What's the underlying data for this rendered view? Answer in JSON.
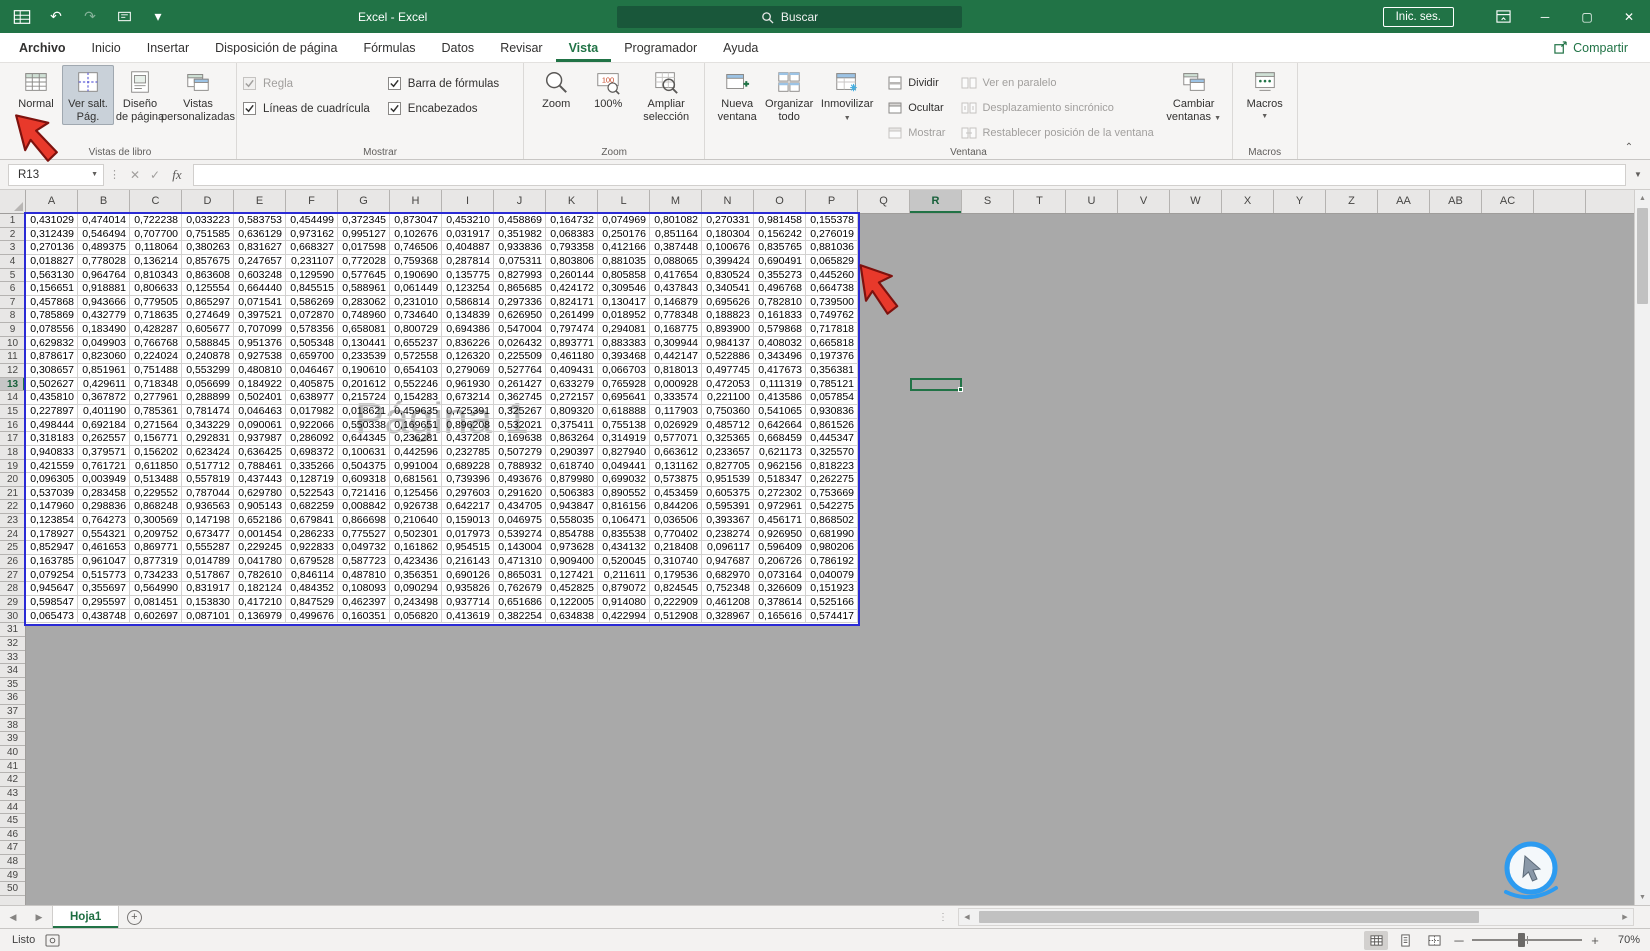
{
  "titlebar": {
    "title": "Excel  -  Excel",
    "search_label": "Buscar",
    "sign_in_label": "Inic. ses."
  },
  "menubar": {
    "tabs": [
      "Archivo",
      "Inicio",
      "Insertar",
      "Disposición de página",
      "Fórmulas",
      "Datos",
      "Revisar",
      "Vista",
      "Programador",
      "Ayuda"
    ],
    "active_tab": "Vista",
    "share_label": "Compartir"
  },
  "ribbon": {
    "book_views": {
      "group_label": "Vistas de libro",
      "normal": "Normal",
      "page_break_line1": "Ver salt.",
      "page_break_line2": "Pág.",
      "page_layout_line1": "Diseño",
      "page_layout_line2": "de página",
      "custom_line1": "Vistas",
      "custom_line2": "personalizadas"
    },
    "show": {
      "group_label": "Mostrar",
      "ruler": "Regla",
      "gridlines": "Líneas de cuadrícula",
      "formula_bar": "Barra de fórmulas",
      "headings": "Encabezados"
    },
    "zoom": {
      "group_label": "Zoom",
      "zoom": "Zoom",
      "hundred": "100%",
      "hundred_icon_text": "100",
      "selection_line1": "Ampliar",
      "selection_line2": "selección"
    },
    "window": {
      "group_label": "Ventana",
      "new_line1": "Nueva",
      "new_line2": "ventana",
      "arrange_line1": "Organizar",
      "arrange_line2": "todo",
      "freeze": "Inmovilizar",
      "split": "Dividir",
      "hide": "Ocultar",
      "unhide": "Mostrar",
      "parallel": "Ver en paralelo",
      "sync": "Desplazamiento sincrónico",
      "reset": "Restablecer posición de la ventana",
      "switch_line1": "Cambiar",
      "switch_line2": "ventanas"
    },
    "macros": {
      "group_label": "Macros",
      "macros": "Macros"
    }
  },
  "formula_bar": {
    "name_box": "R13",
    "fx_label": "fx"
  },
  "sheet": {
    "columns": [
      "A",
      "B",
      "C",
      "D",
      "E",
      "F",
      "G",
      "H",
      "I",
      "J",
      "K",
      "L",
      "M",
      "N",
      "O",
      "P",
      "Q",
      "R",
      "S",
      "T",
      "U",
      "V",
      "W",
      "X",
      "Y",
      "Z",
      "AA",
      "AB",
      "AC"
    ],
    "row_count": 50,
    "selected_column": "R",
    "selected_row": 13,
    "watermark": "Página 1",
    "rows": [
      [
        "0,431029",
        "0,474014",
        "0,722238",
        "0,033223",
        "0,583753",
        "0,454499",
        "0,372345",
        "0,873047",
        "0,453210",
        "0,458869",
        "0,164732",
        "0,074969",
        "0,801082",
        "0,270331",
        "0,981458",
        "0,155378"
      ],
      [
        "0,312439",
        "0,546494",
        "0,707700",
        "0,751585",
        "0,636129",
        "0,973162",
        "0,995127",
        "0,102676",
        "0,031917",
        "0,351982",
        "0,068383",
        "0,250176",
        "0,851164",
        "0,180304",
        "0,156242",
        "0,276019"
      ],
      [
        "0,270136",
        "0,489375",
        "0,118064",
        "0,380263",
        "0,831627",
        "0,668327",
        "0,017598",
        "0,746506",
        "0,404887",
        "0,933836",
        "0,793358",
        "0,412166",
        "0,387448",
        "0,100676",
        "0,835765",
        "0,881036"
      ],
      [
        "0,018827",
        "0,778028",
        "0,136214",
        "0,857675",
        "0,247657",
        "0,231107",
        "0,772028",
        "0,759368",
        "0,287814",
        "0,075311",
        "0,803806",
        "0,881035",
        "0,088065",
        "0,399424",
        "0,690491",
        "0,065829"
      ],
      [
        "0,563130",
        "0,964764",
        "0,810343",
        "0,863608",
        "0,603248",
        "0,129590",
        "0,577645",
        "0,190690",
        "0,135775",
        "0,827993",
        "0,260144",
        "0,805858",
        "0,417654",
        "0,830524",
        "0,355273",
        "0,445260"
      ],
      [
        "0,156651",
        "0,918881",
        "0,806633",
        "0,125554",
        "0,664440",
        "0,845515",
        "0,588961",
        "0,061449",
        "0,123254",
        "0,865685",
        "0,424172",
        "0,309546",
        "0,437843",
        "0,340541",
        "0,496768",
        "0,664738"
      ],
      [
        "0,457868",
        "0,943666",
        "0,779505",
        "0,865297",
        "0,071541",
        "0,586269",
        "0,283062",
        "0,231010",
        "0,586814",
        "0,297336",
        "0,824171",
        "0,130417",
        "0,146879",
        "0,695626",
        "0,782810",
        "0,739500"
      ],
      [
        "0,785869",
        "0,432779",
        "0,718635",
        "0,274649",
        "0,397521",
        "0,072870",
        "0,748960",
        "0,734640",
        "0,134839",
        "0,626950",
        "0,261499",
        "0,018952",
        "0,778348",
        "0,188823",
        "0,161833",
        "0,749762"
      ],
      [
        "0,078556",
        "0,183490",
        "0,428287",
        "0,605677",
        "0,707099",
        "0,578356",
        "0,658081",
        "0,800729",
        "0,694386",
        "0,547004",
        "0,797474",
        "0,294081",
        "0,168775",
        "0,893900",
        "0,579868",
        "0,717818"
      ],
      [
        "0,629832",
        "0,049903",
        "0,766768",
        "0,588845",
        "0,951376",
        "0,505348",
        "0,130441",
        "0,655237",
        "0,836226",
        "0,026432",
        "0,893771",
        "0,883383",
        "0,309944",
        "0,984137",
        "0,408032",
        "0,665818"
      ],
      [
        "0,878617",
        "0,823060",
        "0,224024",
        "0,240878",
        "0,927538",
        "0,659700",
        "0,233539",
        "0,572558",
        "0,126320",
        "0,225509",
        "0,461180",
        "0,393468",
        "0,442147",
        "0,522886",
        "0,343496",
        "0,197376"
      ],
      [
        "0,308657",
        "0,851961",
        "0,751488",
        "0,553299",
        "0,480810",
        "0,046467",
        "0,190610",
        "0,654103",
        "0,279069",
        "0,527764",
        "0,409431",
        "0,066703",
        "0,818013",
        "0,497745",
        "0,417673",
        "0,356381"
      ],
      [
        "0,502627",
        "0,429611",
        "0,718348",
        "0,056699",
        "0,184922",
        "0,405875",
        "0,201612",
        "0,552246",
        "0,961930",
        "0,261427",
        "0,633279",
        "0,765928",
        "0,000928",
        "0,472053",
        "0,111319",
        "0,785121"
      ],
      [
        "0,435810",
        "0,367872",
        "0,277961",
        "0,288899",
        "0,502401",
        "0,638977",
        "0,215724",
        "0,154283",
        "0,673214",
        "0,362745",
        "0,272157",
        "0,695641",
        "0,333574",
        "0,221100",
        "0,413586",
        "0,057854"
      ],
      [
        "0,227897",
        "0,401190",
        "0,785361",
        "0,781474",
        "0,046463",
        "0,017982",
        "0,018621",
        "0,459635",
        "0,725391",
        "0,325267",
        "0,809320",
        "0,618888",
        "0,117903",
        "0,750360",
        "0,541065",
        "0,930836"
      ],
      [
        "0,498444",
        "0,692184",
        "0,271564",
        "0,343229",
        "0,090061",
        "0,922066",
        "0,550338",
        "0,169651",
        "0,896208",
        "0,532021",
        "0,375411",
        "0,755138",
        "0,026929",
        "0,485712",
        "0,642664",
        "0,861526"
      ],
      [
        "0,318183",
        "0,262557",
        "0,156771",
        "0,292831",
        "0,937987",
        "0,286092",
        "0,644345",
        "0,236281",
        "0,437208",
        "0,169638",
        "0,863264",
        "0,314919",
        "0,577071",
        "0,325365",
        "0,668459",
        "0,445347"
      ],
      [
        "0,940833",
        "0,379571",
        "0,156202",
        "0,623424",
        "0,636425",
        "0,698372",
        "0,100631",
        "0,442596",
        "0,232785",
        "0,507279",
        "0,290397",
        "0,827940",
        "0,663612",
        "0,233657",
        "0,621173",
        "0,325570"
      ],
      [
        "0,421559",
        "0,761721",
        "0,611850",
        "0,517712",
        "0,788461",
        "0,335266",
        "0,504375",
        "0,991004",
        "0,689228",
        "0,788932",
        "0,618740",
        "0,049441",
        "0,131162",
        "0,827705",
        "0,962156",
        "0,818223"
      ],
      [
        "0,096305",
        "0,003949",
        "0,513488",
        "0,557819",
        "0,437443",
        "0,128719",
        "0,609318",
        "0,681561",
        "0,739396",
        "0,493676",
        "0,879980",
        "0,699032",
        "0,573875",
        "0,951539",
        "0,518347",
        "0,262275"
      ],
      [
        "0,537039",
        "0,283458",
        "0,229552",
        "0,787044",
        "0,629780",
        "0,522543",
        "0,721416",
        "0,125456",
        "0,297603",
        "0,291620",
        "0,506383",
        "0,890552",
        "0,453459",
        "0,605375",
        "0,272302",
        "0,753669"
      ],
      [
        "0,147960",
        "0,298836",
        "0,868248",
        "0,936563",
        "0,905143",
        "0,682259",
        "0,008842",
        "0,926738",
        "0,642217",
        "0,434705",
        "0,943847",
        "0,816156",
        "0,844206",
        "0,595391",
        "0,972961",
        "0,542275"
      ],
      [
        "0,123854",
        "0,764273",
        "0,300569",
        "0,147198",
        "0,652186",
        "0,679841",
        "0,866698",
        "0,210640",
        "0,159013",
        "0,046975",
        "0,558035",
        "0,106471",
        "0,036506",
        "0,393367",
        "0,456171",
        "0,868502"
      ],
      [
        "0,178927",
        "0,554321",
        "0,209752",
        "0,673477",
        "0,001454",
        "0,286233",
        "0,775527",
        "0,502301",
        "0,017973",
        "0,539274",
        "0,854788",
        "0,835538",
        "0,770402",
        "0,238274",
        "0,926950",
        "0,681990"
      ],
      [
        "0,852947",
        "0,461653",
        "0,869771",
        "0,555287",
        "0,229245",
        "0,922833",
        "0,049732",
        "0,161862",
        "0,954515",
        "0,143004",
        "0,973628",
        "0,434132",
        "0,218408",
        "0,096117",
        "0,596409",
        "0,980206"
      ],
      [
        "0,163785",
        "0,961047",
        "0,877319",
        "0,014789",
        "0,041780",
        "0,679528",
        "0,587723",
        "0,423436",
        "0,216143",
        "0,471310",
        "0,909400",
        "0,520045",
        "0,310740",
        "0,947687",
        "0,206726",
        "0,786192"
      ],
      [
        "0,079254",
        "0,515773",
        "0,734233",
        "0,517867",
        "0,782610",
        "0,846114",
        "0,487810",
        "0,356351",
        "0,690126",
        "0,865031",
        "0,127421",
        "0,211611",
        "0,179536",
        "0,682970",
        "0,073164",
        "0,040079"
      ],
      [
        "0,945647",
        "0,355697",
        "0,564990",
        "0,831917",
        "0,182124",
        "0,484352",
        "0,108093",
        "0,090294",
        "0,935826",
        "0,762679",
        "0,452825",
        "0,879072",
        "0,824545",
        "0,752348",
        "0,326609",
        "0,151923"
      ],
      [
        "0,598547",
        "0,295597",
        "0,081451",
        "0,153830",
        "0,417210",
        "0,847529",
        "0,462397",
        "0,243498",
        "0,937714",
        "0,651686",
        "0,122005",
        "0,914080",
        "0,222909",
        "0,461208",
        "0,378614",
        "0,525166"
      ],
      [
        "0,065473",
        "0,438748",
        "0,602697",
        "0,087101",
        "0,136979",
        "0,499676",
        "0,160351",
        "0,056820",
        "0,413619",
        "0,382254",
        "0,634838",
        "0,422994",
        "0,512908",
        "0,328967",
        "0,165616",
        "0,574417"
      ]
    ]
  },
  "tabs_bar": {
    "sheet_name": "Hoja1"
  },
  "status_bar": {
    "mode": "Listo",
    "zoom_level": "70%"
  }
}
